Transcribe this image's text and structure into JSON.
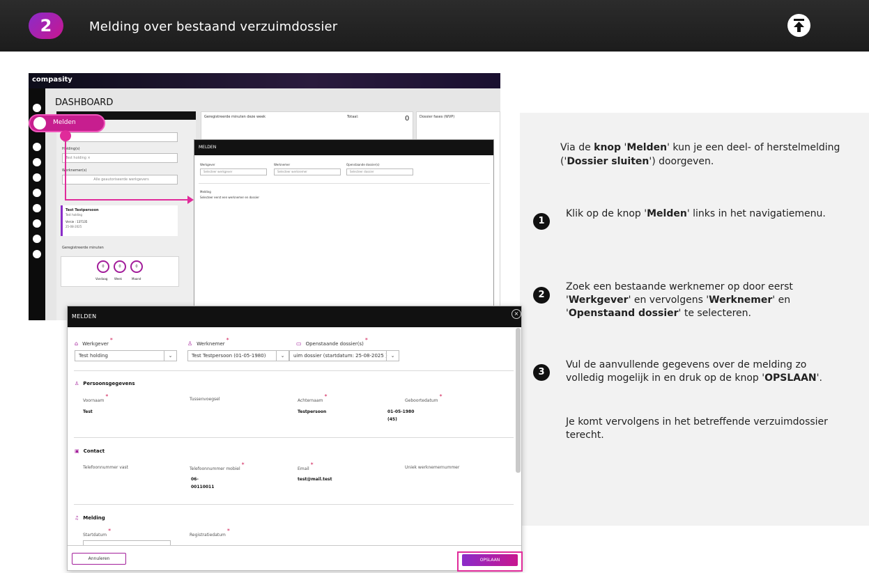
{
  "header": {
    "step_number": "2",
    "title": "Melding over bestaand verzuimdossier"
  },
  "info_panel": {
    "intro_parts": [
      "Via de ",
      "knop",
      " '",
      "Melden",
      "' kun je een deel- of herstelmelding ('",
      "Dossier sluiten",
      "') doorgeven."
    ],
    "steps": [
      {
        "number": "1",
        "parts": [
          "Klik op de knop '",
          "Melden",
          "' links in het navigatiemenu."
        ]
      },
      {
        "number": "2",
        "parts": [
          "Zoek een bestaande werknemer op door eerst '",
          "Werkgever",
          "' en vervolgens '",
          "Werknemer",
          "' en '",
          "Openstaand dossier",
          "' te selecteren."
        ]
      },
      {
        "number": "3",
        "parts": [
          "Vul de aanvullende gegevens over de melding zo volledig mogelijk in en druk op de knop '",
          "OPSLAAN",
          "'."
        ]
      }
    ],
    "footer": "Je komt vervolgens in het betreffende verzuimdossier terecht."
  },
  "dashboard": {
    "logo": "compasity",
    "title": "DASHBOARD",
    "melden_label": "Melden",
    "registered_minutes_label": "Geregistreerde minuten deze week",
    "total_label": "Totaal:",
    "total_value": "0",
    "dossier_fases_label": "Dossier fases (WVP)",
    "holding_label": "Holding(s)",
    "holding_chip": "Test holding ×",
    "employee_label": "Werknemer(s)",
    "select_employee_placeholder": "Alle geautoriseerde werkgevers",
    "card_name": "Test Testpersoon",
    "card_company": "Test holding",
    "card_version": "Versie : 137135",
    "card_date": "25-08-2025",
    "reg_minutes_label": "Geregistreerde minuten",
    "rings": [
      {
        "value": "0",
        "label": "Vandaag"
      },
      {
        "value": "0",
        "label": "Week"
      },
      {
        "value": "0",
        "label": "Maand"
      }
    ]
  },
  "small_modal": {
    "title": "MELDEN",
    "fields": [
      {
        "label": "Werkgever",
        "placeholder": "Selecteer werkgever"
      },
      {
        "label": "Werknemer",
        "placeholder": "Selecteer werknemer"
      },
      {
        "label": "Openstaande dossier(s)",
        "placeholder": "Selecteer dossier"
      }
    ],
    "section": "Melding",
    "hint": "Selecteer eerst een werknemer en dossier"
  },
  "modal": {
    "title": "MELDEN",
    "close_symbol": "×",
    "selectors": [
      {
        "label": "Werkgever",
        "value": "Test holding"
      },
      {
        "label": "Werknemer",
        "value": "Test Testpersoon (01-05-1980)"
      },
      {
        "label": "Openstaande dossier(s)",
        "value": "uim dossier (startdatum: 25-08-2025 )"
      }
    ],
    "persoonsgegevens": {
      "title": "Persoonsgegevens",
      "columns": [
        {
          "label": "Voornaam",
          "value": "Test",
          "required": true
        },
        {
          "label": "Tussenvoegsel",
          "value": "",
          "required": false
        },
        {
          "label": "Achternaam",
          "value": "Testpersoon",
          "required": true
        },
        {
          "label": "Geboortedatum",
          "value": "01-05-1980 (45)",
          "required": true
        }
      ]
    },
    "contact": {
      "title": "Contact",
      "columns": [
        {
          "label": "Telefoonnummer vast",
          "value": "",
          "required": false
        },
        {
          "label": "Telefoonnummer mobiel",
          "value": "06-00110011",
          "required": true
        },
        {
          "label": "Email",
          "value": "test@mail.test",
          "required": true
        },
        {
          "label": "Uniek werknemernummer",
          "value": "",
          "required": false
        }
      ]
    },
    "melding": {
      "title": "Melding",
      "columns": [
        {
          "label": "Startdatum",
          "required": true
        },
        {
          "label": "Registratiedatum",
          "required": true
        }
      ]
    },
    "cancel_label": "Annuleren",
    "save_label": "OPSLAAN"
  },
  "colors": {
    "accent": "#a21d9a",
    "pink": "#e02b9a",
    "header_bg": "#1c1c1c",
    "panel_bg": "#f2f2f2"
  }
}
